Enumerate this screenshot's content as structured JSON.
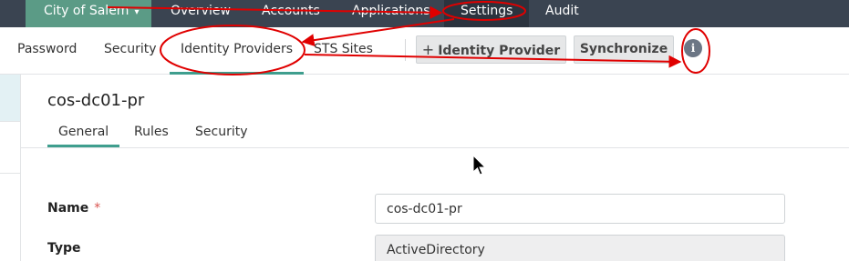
{
  "topnav": {
    "tenant": "City of Salem",
    "items": [
      {
        "label": "Overview"
      },
      {
        "label": "Accounts"
      },
      {
        "label": "Applications"
      },
      {
        "label": "Settings"
      },
      {
        "label": "Audit"
      }
    ]
  },
  "settings_tabs": [
    {
      "label": "Password"
    },
    {
      "label": "Security"
    },
    {
      "label": "Identity Providers"
    },
    {
      "label": "STS Sites"
    }
  ],
  "toolbar": {
    "add_label": "Identity Provider",
    "sync_label": "Synchronize",
    "info_glyph": "i"
  },
  "provider": {
    "title": "cos-dc01-pr",
    "tabs": [
      {
        "label": "General"
      },
      {
        "label": "Rules"
      },
      {
        "label": "Security"
      }
    ],
    "fields": {
      "name_label": "Name",
      "required_mark": "*",
      "name_value": "cos-dc01-pr",
      "type_label": "Type",
      "type_value": "ActiveDirectory"
    }
  },
  "colors": {
    "nav_bg": "#3a4451",
    "accent": "#5b9b86",
    "tab_underline": "#3f9e8e",
    "annotation_red": "#e00000"
  }
}
